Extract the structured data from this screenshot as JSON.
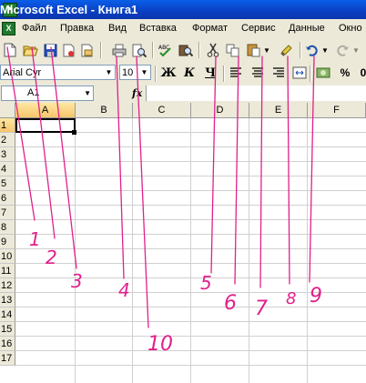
{
  "window": {
    "app_icon": "X",
    "title": "Microsoft Excel - Книга1"
  },
  "menu": {
    "doc_icon": "X",
    "items": [
      "Файл",
      "Правка",
      "Вид",
      "Вставка",
      "Формат",
      "Сервис",
      "Данные",
      "Окно"
    ]
  },
  "toolbar_standard": {
    "icons": [
      "new-document-icon",
      "open-folder-icon",
      "save-icon",
      "permission-icon",
      "email-icon",
      "print-icon",
      "print-preview-icon",
      "spelling-icon",
      "research-icon",
      "cut-icon",
      "copy-icon",
      "paste-icon",
      "format-painter-icon",
      "undo-icon",
      "redo-icon"
    ]
  },
  "toolbar_format": {
    "font_name": "Arial Cyr",
    "font_size": "10",
    "bold": "Ж",
    "italic": "К",
    "underline": "Ч",
    "percent": "%",
    "comma": "0"
  },
  "formula_bar": {
    "name_box": "A1",
    "fx": "fx",
    "content": ""
  },
  "sheet": {
    "columns": [
      "A",
      "B",
      "C",
      "D",
      "E",
      "F"
    ],
    "rows": [
      "1",
      "2",
      "3",
      "4",
      "5",
      "6",
      "7",
      "8",
      "9",
      "10",
      "11",
      "12",
      "13",
      "14",
      "15",
      "16",
      "17"
    ],
    "active_cell": "A1"
  },
  "annotations": {
    "color": "#e0208c",
    "labels": [
      "1",
      "2",
      "3",
      "4",
      "5",
      "6",
      "7",
      "8",
      "9",
      "10"
    ]
  }
}
